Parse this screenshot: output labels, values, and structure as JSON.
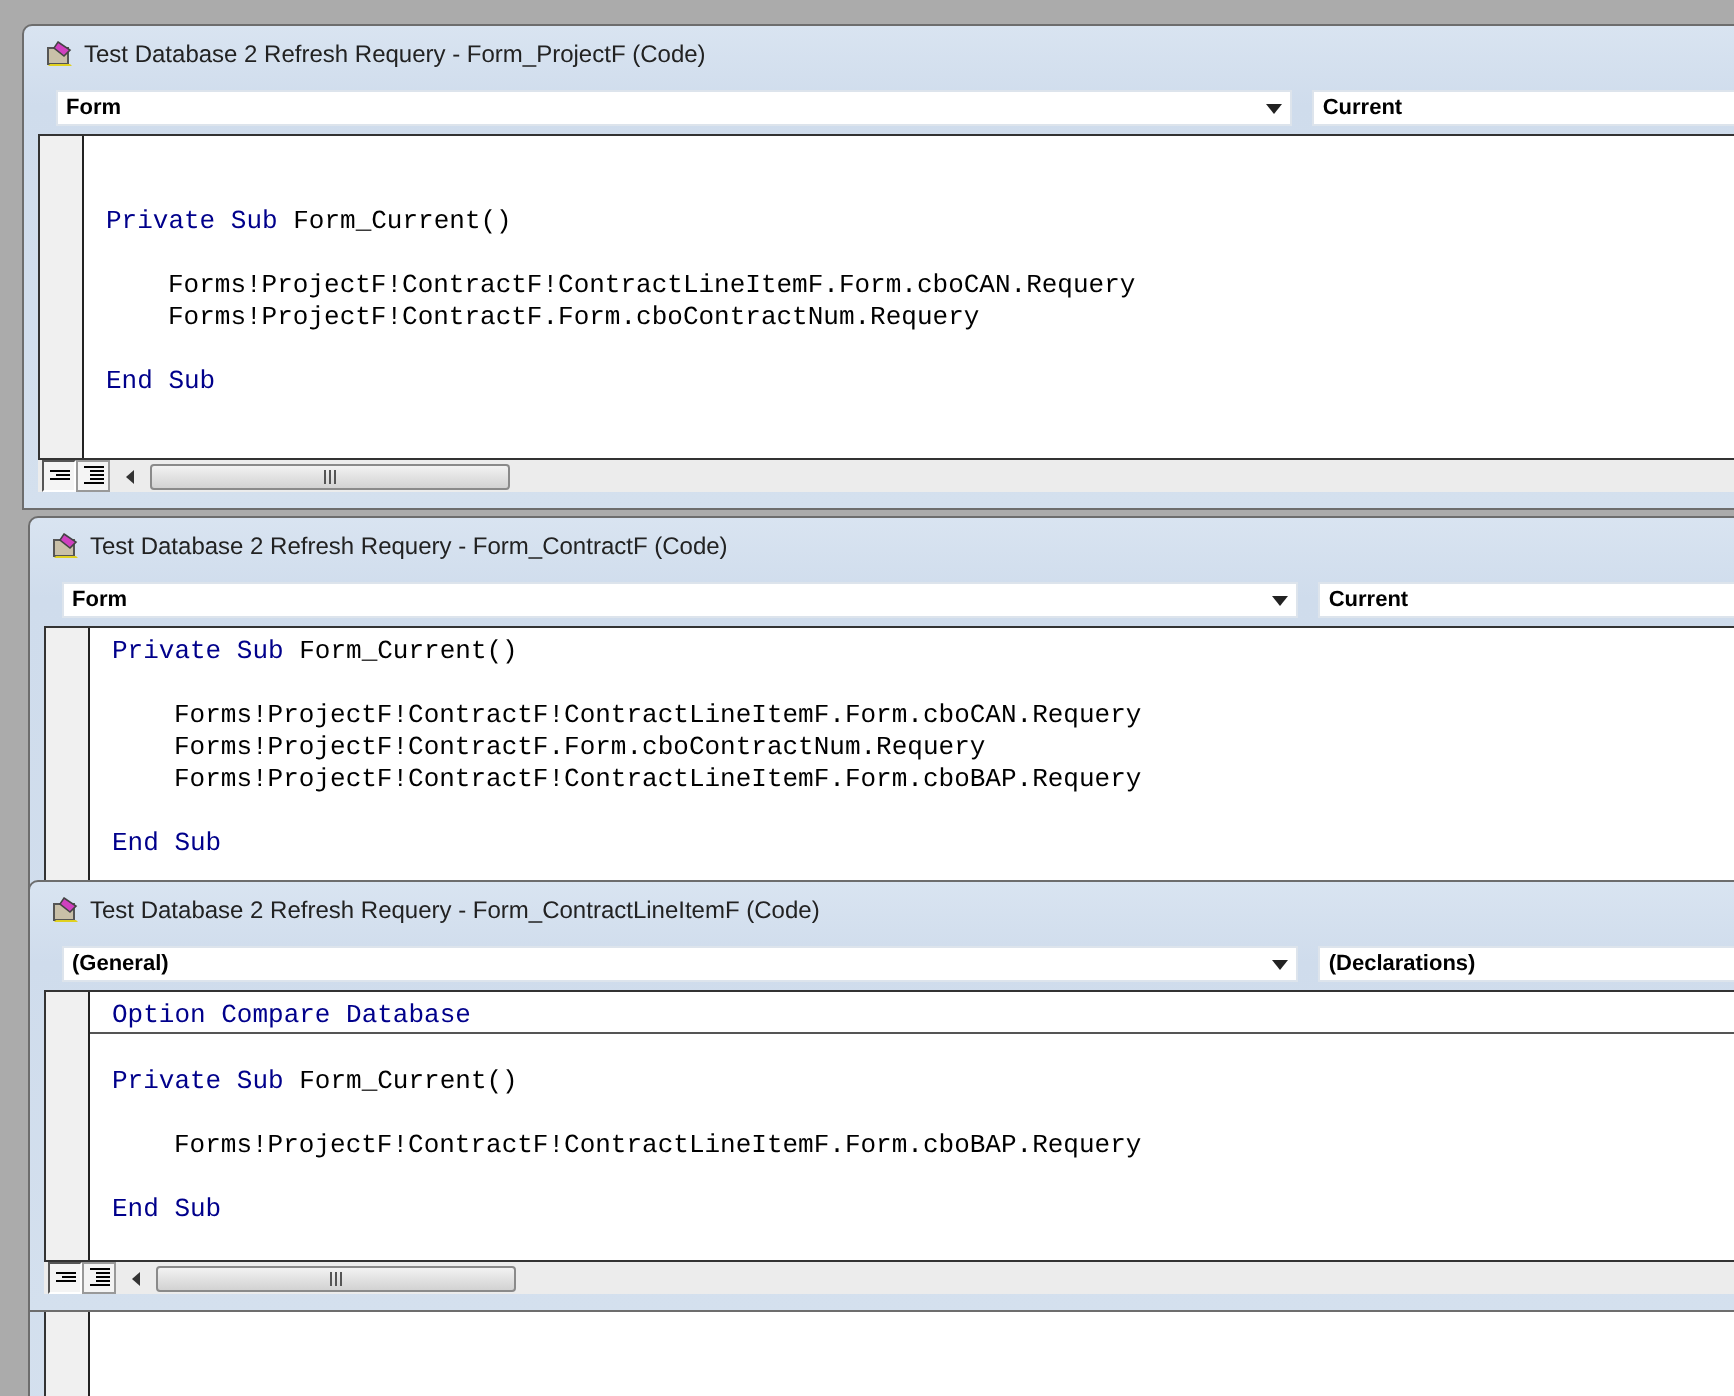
{
  "windows": [
    {
      "title": "Test Database 2 Refresh Requery - Form_ProjectF (Code)",
      "object_combo": "Form",
      "procedure_combo": "Current",
      "scrollbar": true,
      "code": [
        {
          "separator_after": false,
          "lines": [
            {
              "indent": false,
              "tokens": [
                {
                  "text": "Private Sub ",
                  "kind": "keyword"
                },
                {
                  "text": "Form_Current()",
                  "kind": "plain"
                }
              ]
            }
          ]
        },
        {
          "separator_after": false,
          "lines": [
            {
              "indent": true,
              "tokens": [
                {
                  "text": "Forms!ProjectF!ContractF!ContractLineItemF.Form.cboCAN.Requery",
                  "kind": "plain"
                }
              ]
            },
            {
              "indent": true,
              "tokens": [
                {
                  "text": "Forms!ProjectF!ContractF.Form.cboContractNum.Requery",
                  "kind": "plain"
                }
              ]
            }
          ]
        },
        {
          "separator_after": false,
          "lines": [
            {
              "indent": false,
              "tokens": [
                {
                  "text": "End Sub",
                  "kind": "keyword"
                }
              ]
            }
          ]
        }
      ]
    },
    {
      "title": "Test Database 2 Refresh Requery - Form_ContractF (Code)",
      "object_combo": "Form",
      "procedure_combo": "Current",
      "scrollbar": false,
      "code": [
        {
          "separator_after": false,
          "lines": [
            {
              "indent": false,
              "tokens": [
                {
                  "text": "Private Sub ",
                  "kind": "keyword"
                },
                {
                  "text": "Form_Current()",
                  "kind": "plain"
                }
              ]
            }
          ]
        },
        {
          "separator_after": false,
          "lines": [
            {
              "indent": true,
              "tokens": [
                {
                  "text": "Forms!ProjectF!ContractF!ContractLineItemF.Form.cboCAN.Requery",
                  "kind": "plain"
                }
              ]
            },
            {
              "indent": true,
              "tokens": [
                {
                  "text": "Forms!ProjectF!ContractF.Form.cboContractNum.Requery",
                  "kind": "plain"
                }
              ]
            },
            {
              "indent": true,
              "tokens": [
                {
                  "text": "Forms!ProjectF!ContractF!ContractLineItemF.Form.cboBAP.Requery",
                  "kind": "plain"
                }
              ]
            }
          ]
        },
        {
          "separator_after": false,
          "lines": [
            {
              "indent": false,
              "tokens": [
                {
                  "text": "End Sub",
                  "kind": "keyword"
                }
              ]
            }
          ]
        }
      ]
    },
    {
      "title": "Test Database 2 Refresh Requery - Form_ContractLineItemF (Code)",
      "object_combo": "(General)",
      "procedure_combo": "(Declarations)",
      "scrollbar": true,
      "code": [
        {
          "separator_after": true,
          "lines": [
            {
              "indent": false,
              "tokens": [
                {
                  "text": "Option Compare Database",
                  "kind": "keyword"
                }
              ]
            }
          ]
        },
        {
          "separator_after": false,
          "lines": [
            {
              "indent": false,
              "tokens": [
                {
                  "text": "Private Sub ",
                  "kind": "keyword"
                },
                {
                  "text": "Form_Current()",
                  "kind": "plain"
                }
              ]
            }
          ]
        },
        {
          "separator_after": false,
          "lines": [
            {
              "indent": true,
              "tokens": [
                {
                  "text": "Forms!ProjectF!ContractF!ContractLineItemF.Form.cboBAP.Requery",
                  "kind": "plain"
                }
              ]
            }
          ]
        },
        {
          "separator_after": false,
          "lines": [
            {
              "indent": false,
              "tokens": [
                {
                  "text": "End Sub",
                  "kind": "keyword"
                }
              ]
            }
          ]
        }
      ]
    }
  ]
}
